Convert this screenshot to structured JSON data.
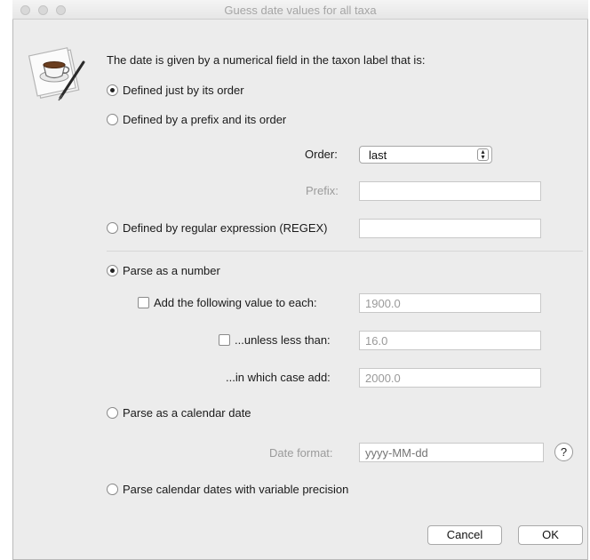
{
  "window": {
    "title": "Guess date values for all taxa"
  },
  "intro": "The date is given by a numerical field in the taxon label that is:",
  "options": {
    "by_order": {
      "label": "Defined just by its order",
      "selected": true
    },
    "by_prefix": {
      "label": "Defined by a prefix and its order",
      "selected": false
    },
    "by_regex": {
      "label": "Defined by regular expression (REGEX)",
      "selected": false,
      "value": ""
    }
  },
  "order": {
    "label": "Order:",
    "value": "last"
  },
  "prefix": {
    "label": "Prefix:",
    "value": ""
  },
  "parse": {
    "number": {
      "label": "Parse as a number",
      "selected": true
    },
    "add_value": {
      "label": "Add the following value to each:",
      "checked": false,
      "value": "1900.0"
    },
    "unless": {
      "label": "...unless less than:",
      "checked": false,
      "value": "16.0"
    },
    "case_add": {
      "label": "...in which case add:",
      "value": "2000.0"
    },
    "calendar": {
      "label": "Parse as a calendar date",
      "selected": false
    },
    "date_format": {
      "label": "Date format:",
      "placeholder": "yyyy-MM-dd"
    },
    "variable": {
      "label": "Parse calendar dates with variable precision",
      "selected": false
    }
  },
  "help": {
    "symbol": "?"
  },
  "buttons": {
    "cancel": "Cancel",
    "ok": "OK"
  },
  "icon": "coffee-cup-app-icon"
}
